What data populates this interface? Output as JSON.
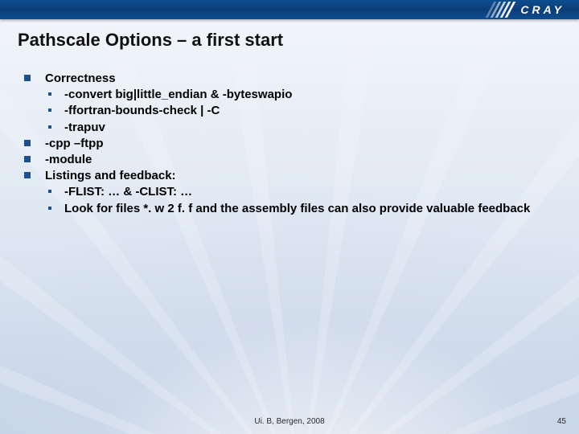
{
  "brand": "CRAY",
  "title": "Pathscale Options – a first start",
  "bullets": [
    {
      "text": "Correctness",
      "sub": [
        "-convert big|little_endian & -byteswapio",
        "-ffortran-bounds-check | -C",
        "-trapuv"
      ]
    },
    {
      "text": "-cpp –ftpp",
      "sub": []
    },
    {
      "text": "-module",
      "sub": []
    },
    {
      "text": "Listings and feedback:",
      "sub": [
        "-FLIST: … & -CLIST: …",
        "Look for files *. w 2 f. f and the assembly files can also provide valuable feedback"
      ]
    }
  ],
  "footer": "Ui. B, Bergen, 2008",
  "page": "45"
}
